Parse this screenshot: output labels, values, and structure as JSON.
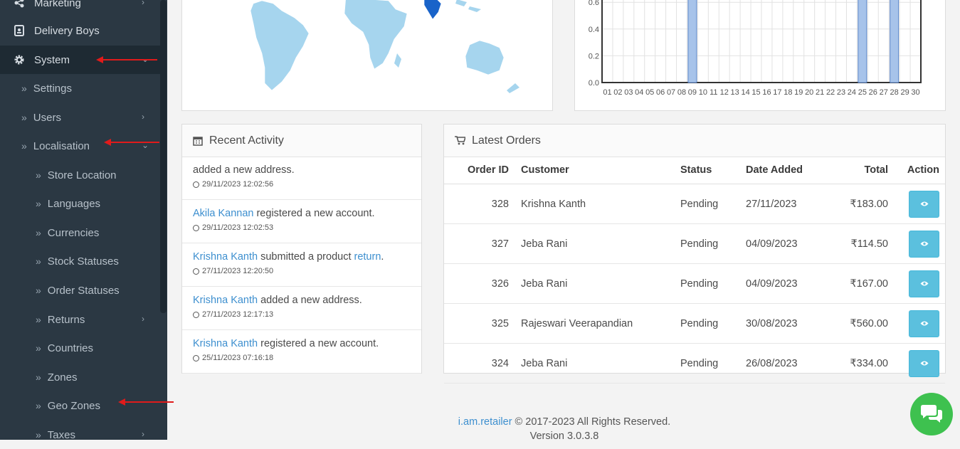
{
  "sidebar": {
    "items": [
      {
        "label": "Marketing",
        "icon": "share-icon"
      },
      {
        "label": "Delivery Boys",
        "icon": "id-badge-icon"
      },
      {
        "label": "System",
        "icon": "gear-icon"
      },
      {
        "label": "Settings"
      },
      {
        "label": "Users"
      },
      {
        "label": "Localisation"
      },
      {
        "label": "Store Location"
      },
      {
        "label": "Languages"
      },
      {
        "label": "Currencies"
      },
      {
        "label": "Stock Statuses"
      },
      {
        "label": "Order Statuses"
      },
      {
        "label": "Returns"
      },
      {
        "label": "Countries"
      },
      {
        "label": "Zones"
      },
      {
        "label": "Geo Zones"
      },
      {
        "label": "Taxes"
      }
    ]
  },
  "colors": {
    "sidebar_bg": "#2b3843",
    "accent": "#5bc0de",
    "link": "#3d8fcf",
    "chart_bar": "#a7c3ea",
    "map_land": "#a6d5ee",
    "map_highlight": "#1963c9",
    "annotation": "#e01b1b",
    "chat": "#3ec14f"
  },
  "chart_data": {
    "type": "bar",
    "categories": [
      "01",
      "02",
      "03",
      "04",
      "05",
      "06",
      "07",
      "08",
      "09",
      "10",
      "11",
      "12",
      "13",
      "14",
      "15",
      "16",
      "17",
      "18",
      "19",
      "20",
      "21",
      "22",
      "23",
      "24",
      "25",
      "26",
      "27",
      "28",
      "29",
      "30"
    ],
    "values": [
      0,
      0,
      0,
      0,
      0,
      0,
      0,
      0,
      1,
      0,
      0,
      0,
      0,
      0,
      0,
      0,
      0,
      0,
      0,
      0,
      0,
      0,
      0,
      0,
      1,
      0,
      0,
      1,
      0,
      0
    ],
    "y_ticks": [
      "0.0",
      "0.2",
      "0.4",
      "0.6"
    ],
    "ylim": [
      0,
      1
    ],
    "grid": true
  },
  "recent_activity": {
    "title": "Recent Activity",
    "items": [
      {
        "pre": "",
        "link": "",
        "text": "added a new address.",
        "link2": "",
        "post": "",
        "time": "29/11/2023 12:02:56"
      },
      {
        "pre": "",
        "link": "Akila Kannan",
        "text": " registered a new account.",
        "link2": "",
        "post": "",
        "time": "29/11/2023 12:02:53"
      },
      {
        "pre": "",
        "link": "Krishna Kanth",
        "text": " submitted a product ",
        "link2": "return",
        "post": ".",
        "time": "27/11/2023 12:20:50"
      },
      {
        "pre": "",
        "link": "Krishna Kanth",
        "text": " added a new address.",
        "link2": "",
        "post": "",
        "time": "27/11/2023 12:17:13"
      },
      {
        "pre": "",
        "link": "Krishna Kanth",
        "text": " registered a new account.",
        "link2": "",
        "post": "",
        "time": "25/11/2023 07:16:18"
      }
    ]
  },
  "latest_orders": {
    "title": "Latest Orders",
    "columns": [
      "Order ID",
      "Customer",
      "Status",
      "Date Added",
      "Total",
      "Action"
    ],
    "rows": [
      {
        "id": "328",
        "customer": "Krishna Kanth",
        "status": "Pending",
        "date": "27/11/2023",
        "total": "₹183.00"
      },
      {
        "id": "327",
        "customer": "Jeba Rani",
        "status": "Pending",
        "date": "04/09/2023",
        "total": "₹114.50"
      },
      {
        "id": "326",
        "customer": "Jeba Rani",
        "status": "Pending",
        "date": "04/09/2023",
        "total": "₹167.00"
      },
      {
        "id": "325",
        "customer": "Rajeswari Veerapandian",
        "status": "Pending",
        "date": "30/08/2023",
        "total": "₹560.00"
      },
      {
        "id": "324",
        "customer": "Jeba Rani",
        "status": "Pending",
        "date": "26/08/2023",
        "total": "₹334.00"
      }
    ]
  },
  "footer": {
    "brand": "i.am.retailer",
    "copyright": " © 2017-2023 All Rights Reserved.",
    "version": "Version 3.0.3.8"
  }
}
